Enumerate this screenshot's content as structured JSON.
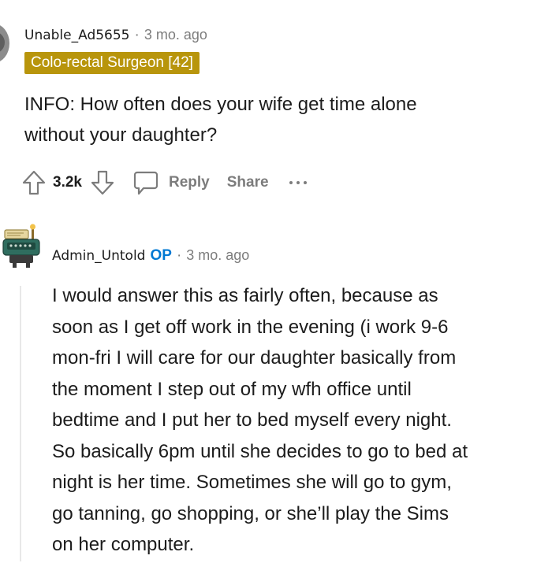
{
  "comment1": {
    "username": "Unable_Ad5655",
    "separator": "·",
    "timestamp": "3 mo. ago",
    "flair": "Colo-rectal Surgeon [42]",
    "body_lines": [
      "INFO: How often does your wife get time alone",
      "without your daughter?"
    ],
    "actions": {
      "vote_count": "3.2k",
      "reply_label": "Reply",
      "share_label": "Share"
    }
  },
  "comment2": {
    "username": "Admin_Untold",
    "op_badge": "OP",
    "separator": "·",
    "timestamp": "3 mo. ago",
    "body_lines": [
      "I would answer this as fairly often, because as",
      "soon as I get off work in the evening (i work 9-6",
      "mon-fri I will care for our daughter basically from",
      "the moment I step out of my wfh office until",
      "bedtime and I put her to bed myself every night.",
      "So basically 6pm until she decides to go to bed at",
      "night is her time. Sometimes she will go to gym,",
      "go tanning, go shopping, or she’ll play the Sims",
      "on her computer."
    ]
  },
  "colors": {
    "flair_bg": "#b8950c",
    "op_badge": "#0079d3",
    "meta_gray": "#7c7c7c"
  },
  "icons": {
    "upvote": "arrow-up-icon",
    "downvote": "arrow-down-icon",
    "reply": "speech-bubble-icon",
    "more": "ellipsis-icon"
  }
}
